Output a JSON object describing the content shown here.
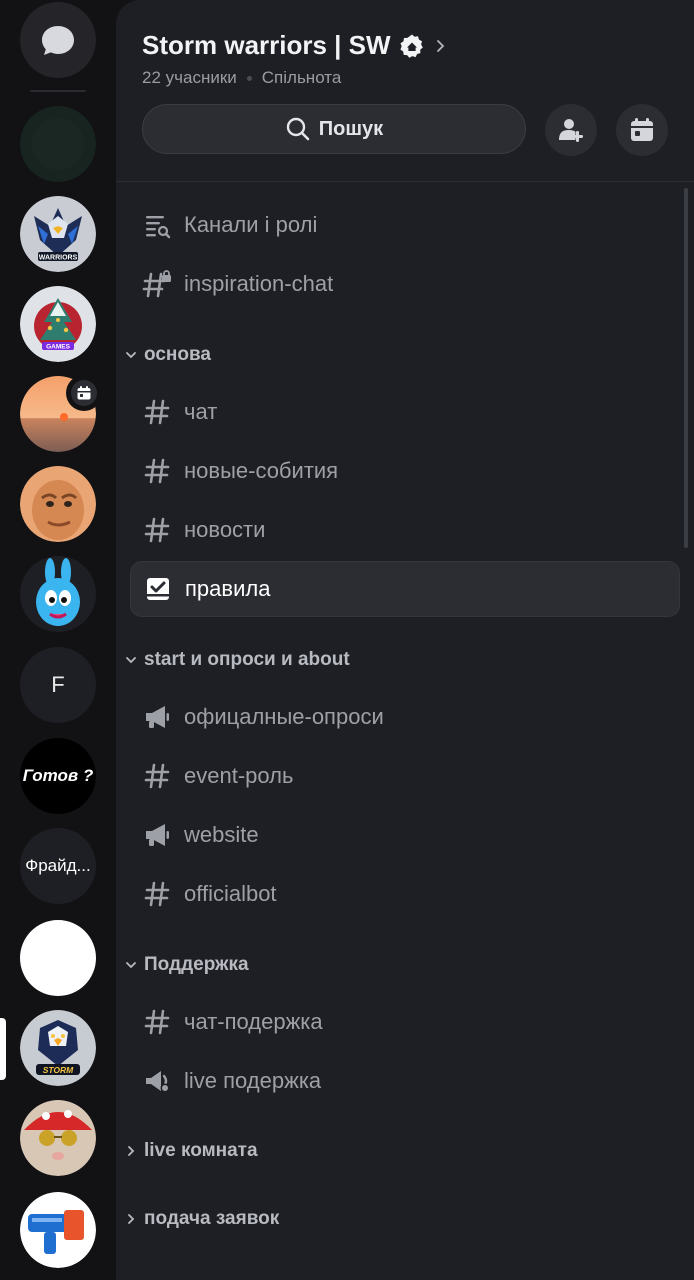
{
  "server": {
    "name": "Storm warriors | SW",
    "members": "22 учасники",
    "type": "Спільнота",
    "search_label": "Пошук"
  },
  "rail": {
    "servers": [
      {
        "kind": "direct-messages"
      },
      {
        "kind": "image",
        "name": "dark-server"
      },
      {
        "kind": "image",
        "name": "warriors-eagle",
        "logo_text": "WARRIORS"
      },
      {
        "kind": "image",
        "name": "games-tree",
        "logo_text": "GAMES"
      },
      {
        "kind": "image",
        "name": "sunset",
        "has_event": true
      },
      {
        "kind": "image",
        "name": "bald-man"
      },
      {
        "kind": "image",
        "name": "blue-rabbit"
      },
      {
        "kind": "letter",
        "text": "F"
      },
      {
        "kind": "text",
        "text": "Готов ?"
      },
      {
        "kind": "text",
        "text": "Фрайд..."
      },
      {
        "kind": "image",
        "name": "white-circle"
      },
      {
        "kind": "image",
        "name": "storm-eagle",
        "logo_text": "STORM",
        "active": true
      },
      {
        "kind": "image",
        "name": "cat-mushroom"
      },
      {
        "kind": "image",
        "name": "blue-blaster"
      }
    ]
  },
  "channels": {
    "top": [
      {
        "label": "Канали і ролі",
        "icon": "channels-roles-icon"
      },
      {
        "label": "inspiration-chat",
        "icon": "locked-hash-icon"
      }
    ],
    "categories": [
      {
        "label": "основа",
        "expanded": true,
        "items": [
          {
            "label": "чат",
            "icon": "hash-icon"
          },
          {
            "label": "новые-собития",
            "icon": "hash-icon"
          },
          {
            "label": "новости",
            "icon": "hash-icon"
          },
          {
            "label": "правила",
            "icon": "rules-icon",
            "active": true
          }
        ]
      },
      {
        "label": "start и опроси и about",
        "expanded": true,
        "items": [
          {
            "label": "офицалные-опроси",
            "icon": "megaphone-icon"
          },
          {
            "label": "event-роль",
            "icon": "hash-icon"
          },
          {
            "label": "website",
            "icon": "megaphone-icon"
          },
          {
            "label": "officialbot",
            "icon": "hash-icon"
          }
        ]
      },
      {
        "label": "Поддержка",
        "expanded": true,
        "items": [
          {
            "label": "чат-подержка",
            "icon": "hash-icon"
          },
          {
            "label": "live подержка",
            "icon": "stage-icon"
          }
        ]
      },
      {
        "label": "live комната",
        "expanded": false,
        "items": []
      },
      {
        "label": "подача заявок",
        "expanded": false,
        "items": []
      }
    ]
  },
  "colors": {
    "rail_bg": "#121214",
    "panel_bg": "#1e1f24",
    "active_row_bg": "#2b2d33",
    "muted_text": "#9ea0a7"
  }
}
